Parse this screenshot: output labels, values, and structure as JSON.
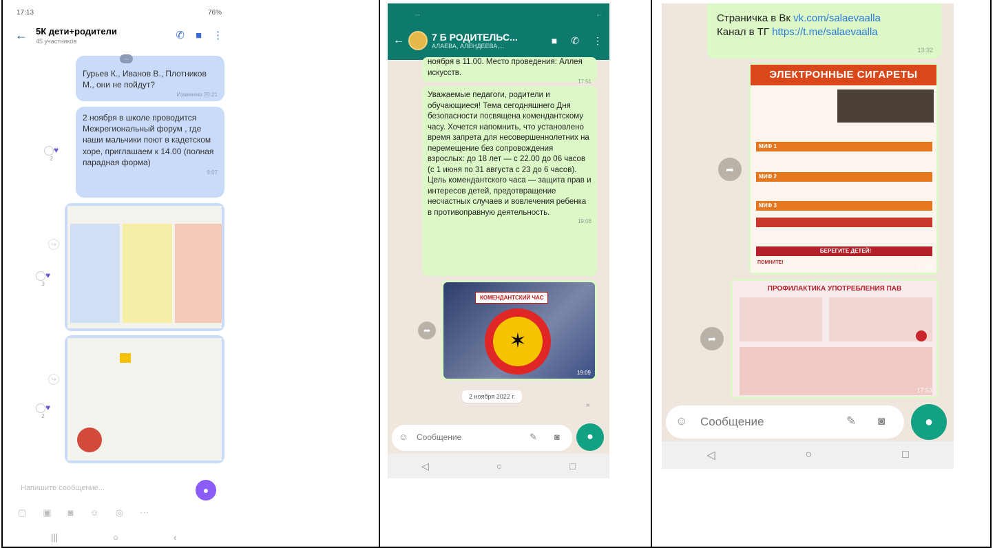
{
  "heading": "",
  "phone1": {
    "status": {
      "time": "17:13",
      "battery": "76%"
    },
    "chat_title": "5К дети+родители",
    "chat_sub": "45 участников",
    "msg1": {
      "text": "Гурьев К., Иванов В., Плотников М., они не пойдут?",
      "time": "Изменено 20:21"
    },
    "msg2": {
      "text": "2 ноября в школе проводится Межрегиональный форум , где наши мальчики поют в кадетском хоре, приглашаем к 14.00 (полная парадная форма)",
      "time": "9:07"
    },
    "reaction_count_1": "2",
    "reaction_count_2": "3",
    "reaction_count_3": "2",
    "composer_placeholder": "Напишите сообщение..."
  },
  "phone2": {
    "chat_title": "7 Б РОДИТЕЛЬС...",
    "chat_sub": "АЛАЕВА, АЛЕНДЕЕВА,...",
    "msg_top": {
      "text": "ноября в 11.00. Место проведения: Аллея искусств.",
      "time": "17:51"
    },
    "msg_main": {
      "text": "Уважаемые педагоги, родители и обучающиеся! Тема сегодняшнего Дня безопасности посвящена комендантскому часу. Хочется напомнить, что установлено время запрета для несовершеннолетних на перемещение без сопровождения взрослых: до 18 лет — с 22.00 до 06 часов (с 1 июня по 31 августа с 23 до 6 часов). Цель комендантского часа — защита прав и интересов детей, предотвращение несчастных случаев и вовлечения ребенка в противоправную деятельность.",
      "time": "19:08"
    },
    "image_label": "КОМЕНДАНТСКИЙ ЧАС",
    "image_time": "19:09",
    "date_chip": "2 ноября 2022 г.",
    "composer_placeholder": "Сообщение"
  },
  "phone3": {
    "link_line1_prefix": "Страничка в Вк ",
    "link_line1_url": "vk.com/salaevaalla",
    "link_line2_prefix": "Канал в ТГ ",
    "link_line2_url": "https://t.me/salaevaalla",
    "link_time": "13:32",
    "poster_a_title": "ЭЛЕКТРОННЫЕ СИГАРЕТЫ",
    "poster_a_footer": "БЕРЕГИТЕ ДЕТЕЙ!",
    "poster_a_remember": "ПОМНИТЕ!",
    "poster_a_time": "17:53",
    "poster_b_title": "ПРОФИЛАКТИКА УПОТРЕБЛЕНИЯ ПАВ",
    "poster_b_time": "17:53",
    "composer_placeholder": "Сообщение"
  },
  "colors": {
    "vk_bubble": "#c9dbf8",
    "wa_header": "#0e7a6d",
    "wa_bubble": "#dcf8c6",
    "wa_mic": "#12a283",
    "vk_mic": "#8b5cf6"
  }
}
